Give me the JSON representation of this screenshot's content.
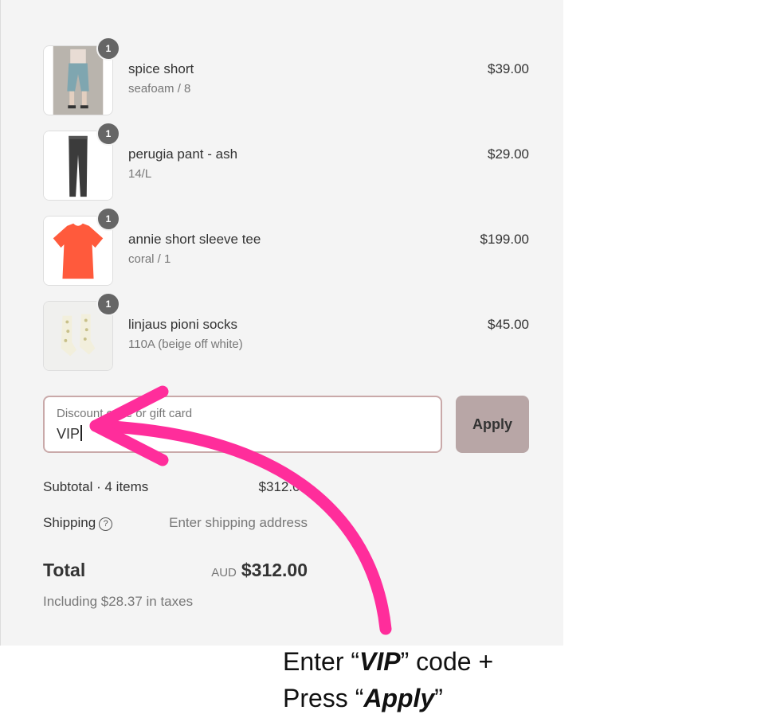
{
  "cart": {
    "items": [
      {
        "name": "spice short",
        "variant": "seafoam / 8",
        "price": "$39.00",
        "quantity": "1",
        "thumbnail_icon": "shorts-icon"
      },
      {
        "name": "perugia pant - ash",
        "variant": "14/L",
        "price": "$29.00",
        "quantity": "1",
        "thumbnail_icon": "pants-icon"
      },
      {
        "name": "annie short sleeve tee",
        "variant": "coral / 1",
        "price": "$199.00",
        "quantity": "1",
        "thumbnail_icon": "tshirt-icon"
      },
      {
        "name": "linjaus pioni socks",
        "variant": "110A (beige off white)",
        "price": "$45.00",
        "quantity": "1",
        "thumbnail_icon": "socks-icon"
      }
    ]
  },
  "discount": {
    "label": "Discount code or gift card",
    "value": "VIP",
    "apply_label": "Apply"
  },
  "summary": {
    "subtotal_label": "Subtotal · 4 items",
    "subtotal_value": "$312.00",
    "shipping_label": "Shipping",
    "shipping_value": "Enter shipping address",
    "total_label": "Total",
    "currency": "AUD",
    "total_value": "$312.00",
    "taxes_note": "Including $28.37 in taxes"
  },
  "annotation": {
    "line1_prefix": "Enter “",
    "line1_code": "VIP",
    "line1_suffix": "” code +",
    "line2_prefix": "Press “",
    "line2_action": "Apply",
    "line2_suffix": "”",
    "arrow_color": "#ff2d9b"
  },
  "colors": {
    "panel_bg": "#f4f4f4",
    "apply_button_bg": "#b8a6a6",
    "field_border": "#c9a9a9",
    "badge_bg": "#666666"
  }
}
